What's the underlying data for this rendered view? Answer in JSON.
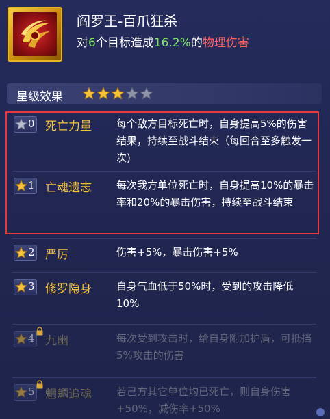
{
  "skill": {
    "title": "阎罗王-百爪狂杀",
    "desc_prefix": "对",
    "target_count": "6",
    "desc_middle": "个目标造成",
    "damage_percent": "16.2%",
    "desc_of": "的",
    "damage_type": "物理伤害",
    "icon": "claw-slash-icon"
  },
  "star_section": {
    "label": "星级效果",
    "current_stars": 3,
    "max_stars": 5
  },
  "effects": [
    {
      "level": "0",
      "name": "死亡力量",
      "text": "每个敌方目标死亡时，自身提高5%的伤害结果，持续至战斗结束（每回合至多触发一次)",
      "active": true,
      "locked": false
    },
    {
      "level": "1",
      "name": "亡魂遗志",
      "text": "每次我方单位死亡时，自身提高10%的暴击率和20%的暴击伤害，持续至战斗结束",
      "active": true,
      "locked": false
    },
    {
      "level": "2",
      "name": "严厉",
      "text": "伤害+5%，暴击伤害+5%",
      "active": true,
      "locked": false
    },
    {
      "level": "3",
      "name": "修罗隐身",
      "text": "自身气血低于50%时，受到的攻击降低10%",
      "active": true,
      "locked": false
    },
    {
      "level": "4",
      "name": "九幽",
      "text": "每次受到攻击时，给自身附加护盾，可抵挡5%攻击的伤害",
      "active": false,
      "locked": true
    },
    {
      "level": "5",
      "name": "魍魉追魂",
      "text": "若己方其它单位均已死亡，则自身伤害+50%，减伤率+50%",
      "active": false,
      "locked": true
    }
  ],
  "colors": {
    "accent_gold": "#f5c23a",
    "highlight_red": "#e8373b",
    "value_green": "#7fe56a",
    "damage_red": "#ff6262"
  }
}
